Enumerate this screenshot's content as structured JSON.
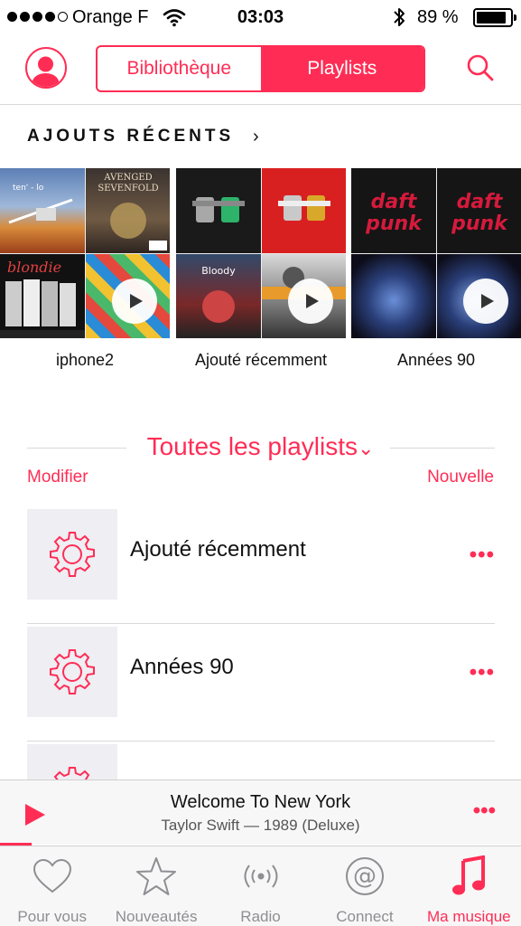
{
  "status_bar": {
    "carrier": "Orange F",
    "time": "03:03",
    "battery_percent": "89 %",
    "battery_level": 0.89
  },
  "header": {
    "segments": [
      {
        "label": "Bibliothèque",
        "active": false
      },
      {
        "label": "Playlists",
        "active": true
      }
    ],
    "accent_color": "#ff2d55"
  },
  "recent": {
    "title": "AJOUTS RÉCENTS",
    "chevron": "›",
    "albums": [
      {
        "label": "iphone2"
      },
      {
        "label": "Ajouté récemment"
      },
      {
        "label": "Années 90"
      }
    ]
  },
  "playlists": {
    "title": "Toutes les playlists",
    "chevron": "⌄",
    "edit_label": "Modifier",
    "new_label": "Nouvelle",
    "items": [
      {
        "name": "Ajouté récemment",
        "more": "•••"
      },
      {
        "name": "Années 90",
        "more": "•••"
      },
      {
        "name": "",
        "more": ""
      }
    ]
  },
  "now_playing": {
    "title": "Welcome To New York",
    "subtitle": "Taylor Swift — 1989 (Deluxe)",
    "more": "•••",
    "progress": 0.06
  },
  "tab_bar": {
    "tabs": [
      {
        "label": "Pour vous",
        "icon": "heart-icon",
        "active": false
      },
      {
        "label": "Nouveautés",
        "icon": "star-icon",
        "active": false
      },
      {
        "label": "Radio",
        "icon": "radio-icon",
        "active": false
      },
      {
        "label": "Connect",
        "icon": "at-icon",
        "active": false
      },
      {
        "label": "Ma musique",
        "icon": "music-note-icon",
        "active": true
      }
    ]
  }
}
